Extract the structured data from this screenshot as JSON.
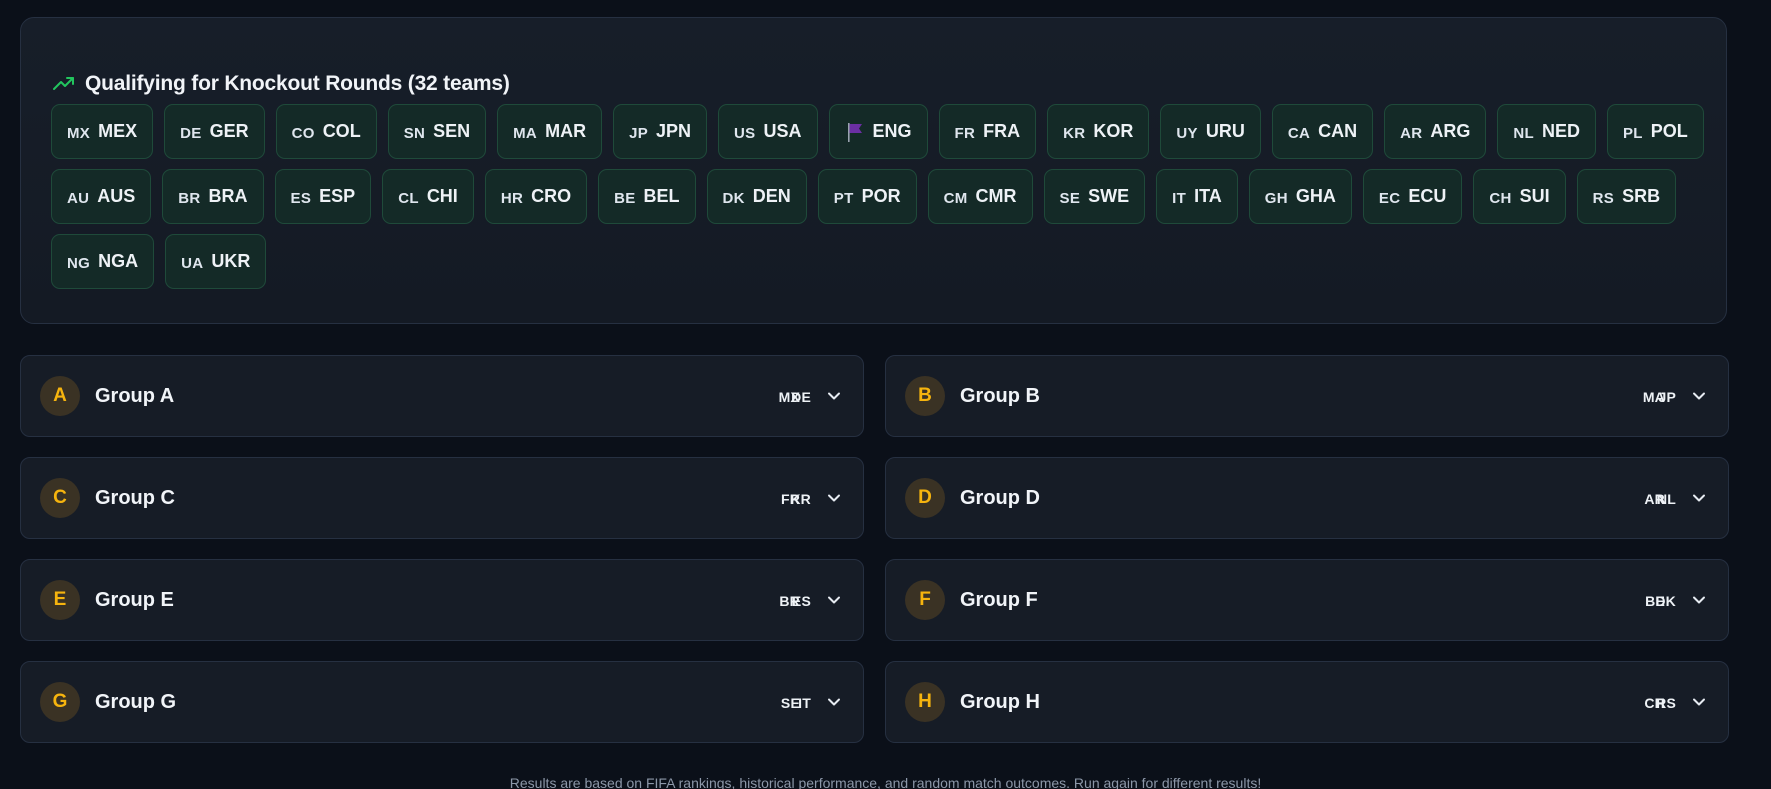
{
  "qualifying": {
    "title": "Qualifying for Knockout Rounds (32 teams)",
    "icon": "trending-up-icon",
    "accent_color": "#22c55e",
    "teams": [
      {
        "flag": "MX",
        "code": "MEX"
      },
      {
        "flag": "DE",
        "code": "GER"
      },
      {
        "flag": "CO",
        "code": "COL"
      },
      {
        "flag": "SN",
        "code": "SEN"
      },
      {
        "flag": "MA",
        "code": "MAR"
      },
      {
        "flag": "JP",
        "code": "JPN"
      },
      {
        "flag": "US",
        "code": "USA"
      },
      {
        "flag": "",
        "code": "ENG",
        "icon": "flag-icon"
      },
      {
        "flag": "FR",
        "code": "FRA"
      },
      {
        "flag": "KR",
        "code": "KOR"
      },
      {
        "flag": "UY",
        "code": "URU"
      },
      {
        "flag": "CA",
        "code": "CAN"
      },
      {
        "flag": "AR",
        "code": "ARG"
      },
      {
        "flag": "NL",
        "code": "NED"
      },
      {
        "flag": "PL",
        "code": "POL"
      },
      {
        "flag": "AU",
        "code": "AUS"
      },
      {
        "flag": "BR",
        "code": "BRA"
      },
      {
        "flag": "ES",
        "code": "ESP"
      },
      {
        "flag": "CL",
        "code": "CHI"
      },
      {
        "flag": "HR",
        "code": "CRO"
      },
      {
        "flag": "BE",
        "code": "BEL"
      },
      {
        "flag": "DK",
        "code": "DEN"
      },
      {
        "flag": "PT",
        "code": "POR"
      },
      {
        "flag": "CM",
        "code": "CMR"
      },
      {
        "flag": "SE",
        "code": "SWE"
      },
      {
        "flag": "IT",
        "code": "ITA"
      },
      {
        "flag": "GH",
        "code": "GHA"
      },
      {
        "flag": "EC",
        "code": "ECU"
      },
      {
        "flag": "CH",
        "code": "SUI"
      },
      {
        "flag": "RS",
        "code": "SRB"
      },
      {
        "flag": "NG",
        "code": "NGA"
      },
      {
        "flag": "UA",
        "code": "UKR"
      }
    ]
  },
  "groups": [
    {
      "letter": "A",
      "name": "Group A",
      "preview": [
        "MX",
        "DE"
      ]
    },
    {
      "letter": "B",
      "name": "Group B",
      "preview": [
        "MA",
        "JP"
      ]
    },
    {
      "letter": "C",
      "name": "Group C",
      "preview": [
        "FR",
        "KR"
      ]
    },
    {
      "letter": "D",
      "name": "Group D",
      "preview": [
        "AR",
        "NL"
      ]
    },
    {
      "letter": "E",
      "name": "Group E",
      "preview": [
        "BR",
        "ES"
      ]
    },
    {
      "letter": "F",
      "name": "Group F",
      "preview": [
        "BE",
        "DK"
      ]
    },
    {
      "letter": "G",
      "name": "Group G",
      "preview": [
        "SE",
        "IT"
      ]
    },
    {
      "letter": "H",
      "name": "Group H",
      "preview": [
        "CH",
        "RS"
      ]
    }
  ],
  "footer": {
    "note": "Results are based on FIFA rankings, historical performance, and random match outcomes. Run again for different results!"
  },
  "colors": {
    "background": "#0b1019",
    "chip_bg": "#142a27",
    "chip_border": "#1f4a3a",
    "badge_text": "#f6b40e",
    "badge_bg": "#3a3224",
    "flag_purple": "#6b2fa3"
  }
}
